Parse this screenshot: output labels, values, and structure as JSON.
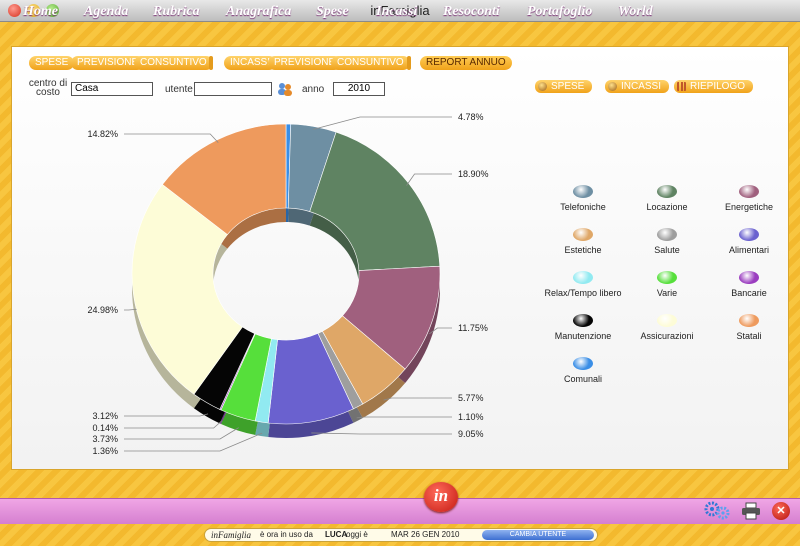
{
  "window": {
    "title": "inFamiglia"
  },
  "top_tabs": {
    "spese": [
      "SPESE",
      "PREVISIONE",
      "CONSUNTIVO"
    ],
    "incassi": [
      "INCASSI",
      "PREVISIONE",
      "CONSUNTIVO"
    ],
    "report": "REPORT ANNUO"
  },
  "filters": {
    "centro_label": "centro di costo",
    "centro_value": "Casa",
    "utente_label": "utente",
    "utente_value": "",
    "anno_label": "anno",
    "anno_value": "2010"
  },
  "report_tabs": [
    "SPESE",
    "INCASSI",
    "RIEPILOGO"
  ],
  "chart_data": {
    "type": "pie",
    "donut": true,
    "slices": [
      {
        "label": "Comunali",
        "value": 0.49,
        "display": "0.49%",
        "color": "#3a8ee6"
      },
      {
        "label": "Telefoniche",
        "value": 4.78,
        "display": "4.78%",
        "color": "#6e8fa3"
      },
      {
        "label": "Locazione",
        "value": 18.9,
        "display": "18.90%",
        "color": "#5f8362"
      },
      {
        "label": "Energetiche",
        "value": 11.75,
        "display": "11.75%",
        "color": "#a0607e"
      },
      {
        "label": "Estetiche",
        "value": 5.77,
        "display": "5.77%",
        "color": "#dfa767"
      },
      {
        "label": "Salute",
        "value": 1.1,
        "display": "1.10%",
        "color": "#9e9e9e"
      },
      {
        "label": "Alimentari",
        "value": 9.05,
        "display": "9.05%",
        "color": "#6a61cf"
      },
      {
        "label": "Relax/Tempo libero",
        "value": 1.36,
        "display": "1.36%",
        "color": "#91eaf1"
      },
      {
        "label": "Varie",
        "value": 3.73,
        "display": "3.73%",
        "color": "#56df3b"
      },
      {
        "label": "Bancarie",
        "value": 0.14,
        "display": "0.14%",
        "color": "#9a3cbf"
      },
      {
        "label": "Manutenzione",
        "value": 3.12,
        "display": "3.12%",
        "color": "#050505"
      },
      {
        "label": "Assicurazioni",
        "value": 24.98,
        "display": "24.98%",
        "color": "#fdfcd7"
      },
      {
        "label": "Statali",
        "value": 14.82,
        "display": "14.82%",
        "color": "#ee9a5d"
      }
    ]
  },
  "legend": [
    {
      "label": "Telefoniche",
      "color": "#6e8fa3"
    },
    {
      "label": "Locazione",
      "color": "#5f8362"
    },
    {
      "label": "Energetiche",
      "color": "#a0607e"
    },
    {
      "label": "Estetiche",
      "color": "#dfa767"
    },
    {
      "label": "Salute",
      "color": "#9e9e9e"
    },
    {
      "label": "Alimentari",
      "color": "#6a61cf"
    },
    {
      "label": "Relax/Tempo libero",
      "color": "#91eaf1"
    },
    {
      "label": "Varie",
      "color": "#56df3b"
    },
    {
      "label": "Bancarie",
      "color": "#9a3cbf"
    },
    {
      "label": "Manutenzione",
      "color": "#050505"
    },
    {
      "label": "Assicurazioni",
      "color": "#fdfcd7"
    },
    {
      "label": "Statali",
      "color": "#ee9a5d"
    },
    {
      "label": "Comunali",
      "color": "#3a8ee6"
    }
  ],
  "nav": [
    "Home",
    "Agenda",
    "Rubrica",
    "Anagrafica",
    "Spese",
    "Incassi",
    "Resoconti",
    "Portafoglio",
    "World"
  ],
  "logo": "in",
  "status": {
    "app_name": "inFamiglia",
    "in_use_text": "è ora in uso da",
    "user": "LUCA",
    "today_label": "oggi è",
    "date": "MAR 26 GEN 2010",
    "change_user": "CAMBIA UTENTE"
  },
  "icons": {
    "settings": "gears-icon",
    "print": "printer-icon",
    "close": "close-icon"
  }
}
